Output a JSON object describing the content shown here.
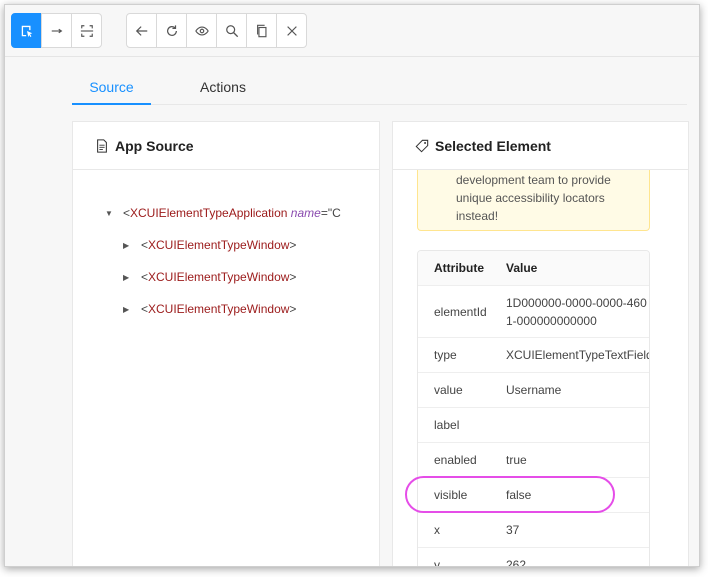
{
  "toolbar": {
    "group1": [
      {
        "name": "select-icon",
        "active": true
      },
      {
        "name": "swipe-icon",
        "active": false
      },
      {
        "name": "tap-by-coordinates-icon",
        "active": false
      }
    ],
    "group2": [
      {
        "name": "back-icon"
      },
      {
        "name": "refresh-icon"
      },
      {
        "name": "eye-icon"
      },
      {
        "name": "search-icon"
      },
      {
        "name": "copy-icon"
      },
      {
        "name": "close-icon"
      }
    ]
  },
  "tabs": {
    "source": "Source",
    "actions": "Actions"
  },
  "app_source": {
    "title": "App Source",
    "root": {
      "tag": "XCUIElementTypeApplication",
      "attr": "name",
      "value_prefix": "\"C"
    },
    "children": [
      "XCUIElementTypeWindow",
      "XCUIElementTypeWindow",
      "XCUIElementTypeWindow"
    ]
  },
  "selected_element": {
    "title": "Selected Element",
    "warning_text": "development team to provide\nunique accessibility locators\ninstead!",
    "table": {
      "headers": [
        "Attribute",
        "Value"
      ],
      "rows": [
        {
          "attribute": "elementId",
          "value": "1D000000-0000-0000-4601-000000000000"
        },
        {
          "attribute": "type",
          "value": "XCUIElementTypeTextField"
        },
        {
          "attribute": "value",
          "value": "Username"
        },
        {
          "attribute": "label",
          "value": ""
        },
        {
          "attribute": "enabled",
          "value": "true"
        },
        {
          "attribute": "visible",
          "value": "false"
        },
        {
          "attribute": "x",
          "value": "37"
        },
        {
          "attribute": "y",
          "value": "262"
        }
      ]
    }
  },
  "colors": {
    "accent": "#1890ff",
    "highlight": "#e54de8",
    "tag": "#9b1a1a"
  }
}
